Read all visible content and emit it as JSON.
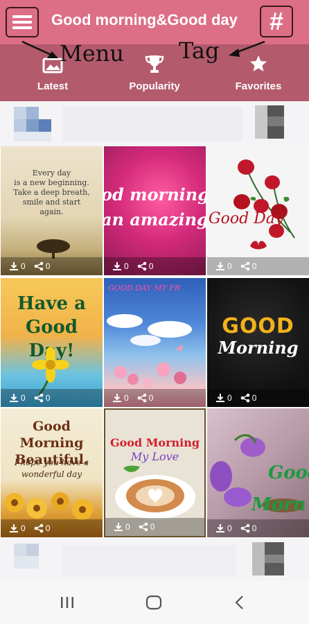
{
  "header": {
    "title": "Good morning&Good day",
    "tag_symbol": "#"
  },
  "annotations": {
    "menu": "Menu",
    "tag": "Tag"
  },
  "tabs": [
    {
      "label": "Latest",
      "icon": "image-icon"
    },
    {
      "label": "Popularity",
      "icon": "trophy-icon"
    },
    {
      "label": "Favorites",
      "icon": "star-icon"
    }
  ],
  "cards": [
    {
      "text": [
        "Every day",
        "is a new beginning.",
        "Take a deep breath,",
        "smile and start",
        "again."
      ],
      "downloads": "0",
      "shares": "0"
    },
    {
      "text": [
        "od morning",
        "an amazing"
      ],
      "downloads": "0",
      "shares": "0"
    },
    {
      "text": [
        "Good Day"
      ],
      "downloads": "0",
      "shares": "0"
    },
    {
      "text": [
        "Have a",
        "Good Day!"
      ],
      "downloads": "0",
      "shares": "0"
    },
    {
      "text": [
        "GOOD DAY MY FR"
      ],
      "downloads": "0",
      "shares": "0"
    },
    {
      "text": [
        "GOOD",
        "Morning"
      ],
      "downloads": "0",
      "shares": "0"
    },
    {
      "text": [
        "Good Morning",
        "Beautiful.",
        "I hope you have a",
        "wonderful day"
      ],
      "downloads": "0",
      "shares": "0"
    },
    {
      "text": [
        "Good Morning",
        "My Love"
      ],
      "downloads": "0",
      "shares": "0"
    },
    {
      "text": [
        "Good",
        "Morn"
      ],
      "downloads": "0",
      "shares": "0"
    }
  ],
  "nav": [
    "recent-apps-icon",
    "home-icon",
    "back-icon"
  ]
}
